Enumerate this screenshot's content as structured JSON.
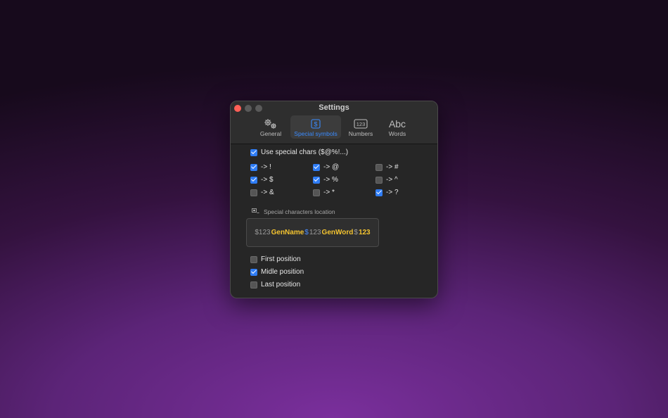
{
  "window": {
    "title": "Settings"
  },
  "tabs": [
    {
      "label": "General",
      "icon": "gears-icon",
      "selected": false
    },
    {
      "label": "Special symbols",
      "icon": "dollar-square-icon",
      "selected": true
    },
    {
      "label": "Numbers",
      "icon": "numbers-123-icon",
      "selected": false
    },
    {
      "label": "Words",
      "icon": "abc-icon",
      "icon_text": "Abc",
      "selected": false
    }
  ],
  "special": {
    "use_label": "Use special chars ($@%!...)",
    "use_checked": true,
    "symbols": [
      {
        "label": "-> !",
        "checked": true
      },
      {
        "label": "-> @",
        "checked": true
      },
      {
        "label": "-> #",
        "checked": false
      },
      {
        "label": "-> $",
        "checked": true
      },
      {
        "label": "-> %",
        "checked": true
      },
      {
        "label": "-> ^",
        "checked": false
      },
      {
        "label": "-> &",
        "checked": false
      },
      {
        "label": "-> *",
        "checked": false
      },
      {
        "label": "-> ?",
        "checked": true
      }
    ]
  },
  "location": {
    "label": "Special characters location",
    "preview": [
      {
        "text": "$123",
        "style": "grey"
      },
      {
        "text": "GenName",
        "style": "yellow"
      },
      {
        "text": "$",
        "style": "blue"
      },
      {
        "text": "123",
        "style": "grey"
      },
      {
        "text": "GenWord",
        "style": "yellow"
      },
      {
        "text": "$",
        "style": "grey"
      },
      {
        "text": "123",
        "style": "yellow"
      }
    ],
    "positions": [
      {
        "label": "First position",
        "checked": false
      },
      {
        "label": "Midle position",
        "checked": true
      },
      {
        "label": "Last position",
        "checked": false
      }
    ]
  },
  "colors": {
    "accent": "#2f7df6",
    "highlight": "#f4c430"
  }
}
